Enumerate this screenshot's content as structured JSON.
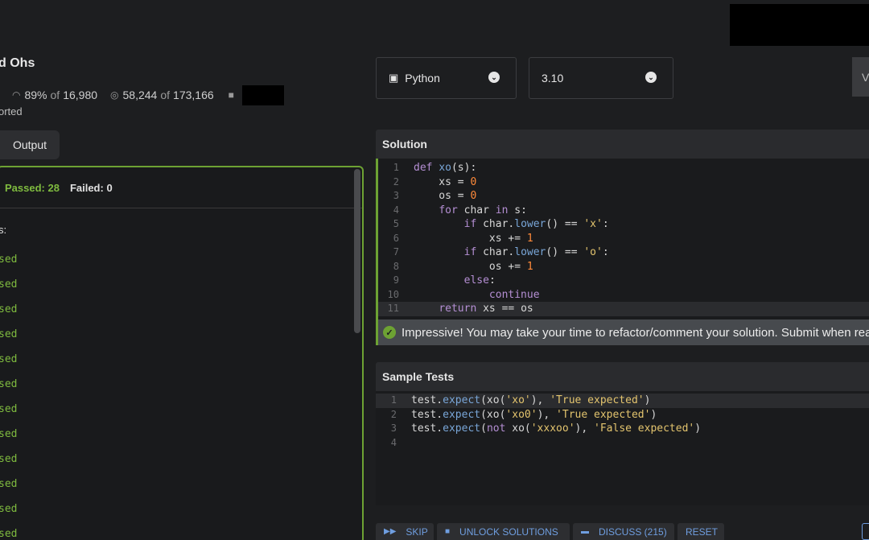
{
  "kata": {
    "title_partial": "d Ohs",
    "satisfaction": "89%",
    "satisfaction_of": "of",
    "votes": "16,980",
    "completions": "58,244",
    "completions_of": "of",
    "attempts": "173,166",
    "supported_partial": "orted",
    "icons": {
      "satisfaction": "eye-icon",
      "completions": "target-icon",
      "author": "user-icon"
    }
  },
  "output_tab": {
    "label": "Output"
  },
  "results": {
    "passed_label": "Passed: 28",
    "failed_label": "Failed: 0",
    "tests_label_partial": "s:",
    "items": [
      "sed",
      "sed",
      "sed",
      "sed",
      "sed",
      "sed",
      "sed",
      "sed",
      "sed",
      "sed",
      "sed",
      "sed"
    ]
  },
  "language_select": {
    "value": "Python",
    "icon": "python-icon"
  },
  "version_select": {
    "value": "3.10"
  },
  "partial_button": {
    "label": "V"
  },
  "solution": {
    "title": "Solution",
    "line_numbers": [
      "1",
      "2",
      "3",
      "4",
      "5",
      "6",
      "7",
      "8",
      "9",
      "10",
      "11"
    ]
  },
  "success_message": "Impressive! You may take your time to refactor/comment your solution. Submit when ready.",
  "sample_tests": {
    "title": "Sample Tests",
    "line_numbers": [
      "1",
      "2",
      "3",
      "4"
    ]
  },
  "actions": {
    "skip": "SKIP",
    "unlock": "UNLOCK SOLUTIONS",
    "discuss": "DISCUSS (215)",
    "reset": "RESET"
  },
  "colors": {
    "accent_green": "#6da233",
    "link_blue": "#6f9ee0",
    "background": "#1d1e20"
  }
}
